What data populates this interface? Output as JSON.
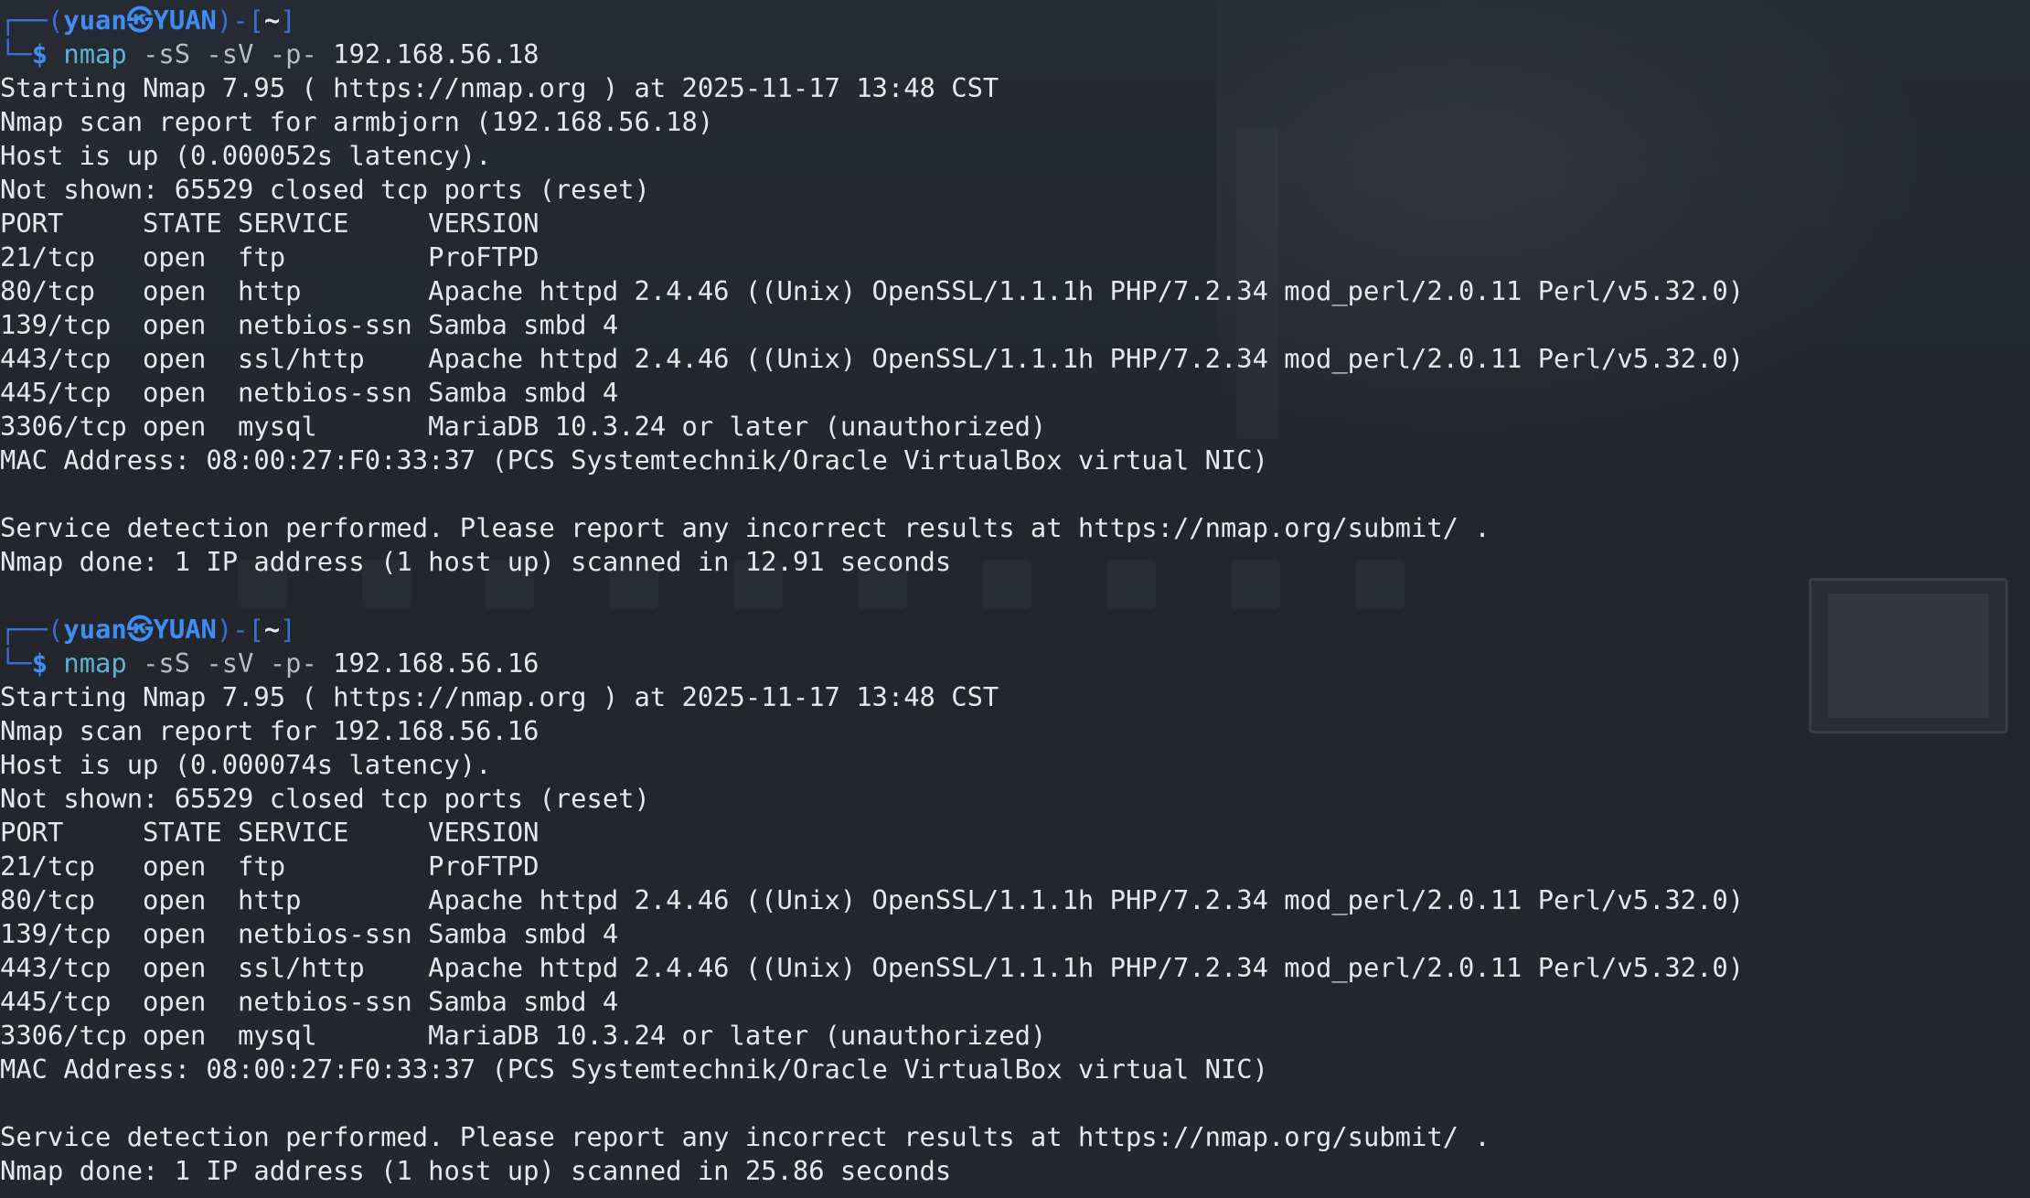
{
  "theme": {
    "background": "#23262d",
    "text": "#e6e8ee",
    "prompt_blue": "#3f8df2",
    "command_cyan": "#5db3d6"
  },
  "prompt": {
    "user": "yuan",
    "separator_icon": "kali-dragon-icon",
    "host": "YUAN",
    "dir": "~"
  },
  "scans": [
    {
      "command": {
        "name": "nmap",
        "args": "-sS -sV -p-",
        "target": "192.168.56.18"
      },
      "output": [
        "Starting Nmap 7.95 ( https://nmap.org ) at 2025-11-17 13:48 CST",
        "Nmap scan report for armbjorn (192.168.56.18)",
        "Host is up (0.000052s latency).",
        "Not shown: 65529 closed tcp ports (reset)",
        "PORT     STATE SERVICE     VERSION",
        "21/tcp   open  ftp         ProFTPD",
        "80/tcp   open  http        Apache httpd 2.4.46 ((Unix) OpenSSL/1.1.1h PHP/7.2.34 mod_perl/2.0.11 Perl/v5.32.0)",
        "139/tcp  open  netbios-ssn Samba smbd 4",
        "443/tcp  open  ssl/http    Apache httpd 2.4.46 ((Unix) OpenSSL/1.1.1h PHP/7.2.34 mod_perl/2.0.11 Perl/v5.32.0)",
        "445/tcp  open  netbios-ssn Samba smbd 4",
        "3306/tcp open  mysql       MariaDB 10.3.24 or later (unauthorized)",
        "MAC Address: 08:00:27:F0:33:37 (PCS Systemtechnik/Oracle VirtualBox virtual NIC)",
        "",
        "Service detection performed. Please report any incorrect results at https://nmap.org/submit/ .",
        "Nmap done: 1 IP address (1 host up) scanned in 12.91 seconds"
      ]
    },
    {
      "command": {
        "name": "nmap",
        "args": "-sS -sV -p-",
        "target": "192.168.56.16"
      },
      "output": [
        "Starting Nmap 7.95 ( https://nmap.org ) at 2025-11-17 13:48 CST",
        "Nmap scan report for 192.168.56.16",
        "Host is up (0.000074s latency).",
        "Not shown: 65529 closed tcp ports (reset)",
        "PORT     STATE SERVICE     VERSION",
        "21/tcp   open  ftp         ProFTPD",
        "80/tcp   open  http        Apache httpd 2.4.46 ((Unix) OpenSSL/1.1.1h PHP/7.2.34 mod_perl/2.0.11 Perl/v5.32.0)",
        "139/tcp  open  netbios-ssn Samba smbd 4",
        "443/tcp  open  ssl/http    Apache httpd 2.4.46 ((Unix) OpenSSL/1.1.1h PHP/7.2.34 mod_perl/2.0.11 Perl/v5.32.0)",
        "445/tcp  open  netbios-ssn Samba smbd 4",
        "3306/tcp open  mysql       MariaDB 10.3.24 or later (unauthorized)",
        "MAC Address: 08:00:27:F0:33:37 (PCS Systemtechnik/Oracle VirtualBox virtual NIC)",
        "",
        "Service detection performed. Please report any incorrect results at https://nmap.org/submit/ .",
        "Nmap done: 1 IP address (1 host up) scanned in 25.86 seconds"
      ]
    }
  ]
}
